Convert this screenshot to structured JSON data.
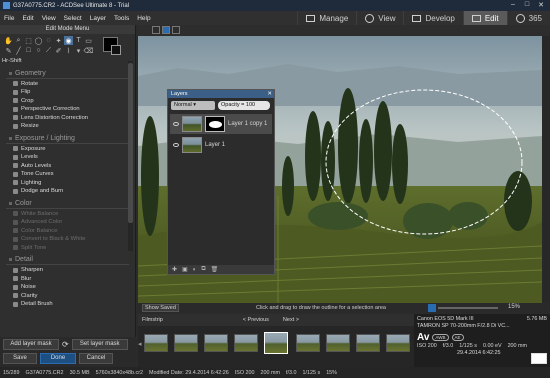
{
  "window": {
    "title": "G37A0775.CR2 - ACDSee Ultimate 8 - Trial"
  },
  "menubar": {
    "items": [
      "File",
      "Edit",
      "View",
      "Select",
      "Layer",
      "Tools",
      "Help"
    ],
    "modes": [
      {
        "label": "Manage",
        "icon": "grid-icon"
      },
      {
        "label": "View",
        "icon": "eye-icon"
      },
      {
        "label": "Develop",
        "icon": "film-icon"
      },
      {
        "label": "Edit",
        "icon": "pencil-icon",
        "active": true
      },
      {
        "label": "365",
        "icon": "cloud-icon"
      }
    ]
  },
  "left_panel": {
    "mode_menu": "Edit Mode Menu",
    "tool_label": "Hr-Shift",
    "sections": [
      {
        "title": "Geometry",
        "items": [
          "Rotate",
          "Flip",
          "Crop",
          "Perspective Correction",
          "Lens Distortion Correction",
          "Resize"
        ]
      },
      {
        "title": "Exposure / Lighting",
        "items": [
          "Exposure",
          "Levels",
          "Auto Levels",
          "Tone Curves",
          "Lighting",
          "Dodge and Burn"
        ]
      },
      {
        "title": "Color",
        "items": [
          "White Balance",
          "Advanced Color",
          "Color Balance",
          "Convert to Black & White",
          "Split Tone"
        ],
        "disabled": true
      },
      {
        "title": "Detail",
        "items": [
          "Sharpen",
          "Blur",
          "Noise",
          "Clarity",
          "Detail Brush"
        ]
      }
    ],
    "add_layer_mask": "Add layer mask",
    "set_layer_mask": "Set layer mask",
    "save": "Save",
    "done": "Done",
    "cancel": "Cancel"
  },
  "layers_panel": {
    "title": "Layers",
    "blend_mode": "Normal",
    "opacity": "Opacity = 100",
    "layers": [
      {
        "name": "Layer 1 copy 1",
        "selected": true,
        "has_mask": true
      },
      {
        "name": "Layer 1",
        "selected": false,
        "has_mask": false
      }
    ]
  },
  "status": {
    "show_saved": "Show Saved",
    "hint": "Click and drag to draw the outline for a selection area",
    "zoom": "15%"
  },
  "filmstrip": {
    "label": "Filmstrip",
    "previous": "< Previous",
    "next": "Next >",
    "thumbs": [
      0,
      1,
      2,
      3,
      4,
      5,
      6,
      7,
      8,
      9
    ],
    "selected_index": 4
  },
  "info": {
    "camera": "Canon EOS 5D Mark III",
    "file_size": "5.76 MB",
    "lens": "TAMRON SP 70-200mm F/2.8 Di VC...",
    "mode": "Av",
    "awb": "AWB",
    "ae": "AE",
    "iso": "ISO 200",
    "aperture": "f/3.0",
    "shutter": "1/125 s",
    "ev": "0.00 eV",
    "focal": "200 mm",
    "datetime": "29.4.2014 6:42:25"
  },
  "footer": {
    "index": "15/289",
    "filename": "G37A0775.CR2",
    "size": "30.5 MB",
    "dims": "5760x3840x48b.cr2",
    "modified": "Modified Date: 29.4.2014 6:42:26",
    "iso": "ISO 200",
    "focal": "200 mm",
    "aperture": "f/3.0",
    "shutter": "1/125 s",
    "zoom": "15%"
  }
}
